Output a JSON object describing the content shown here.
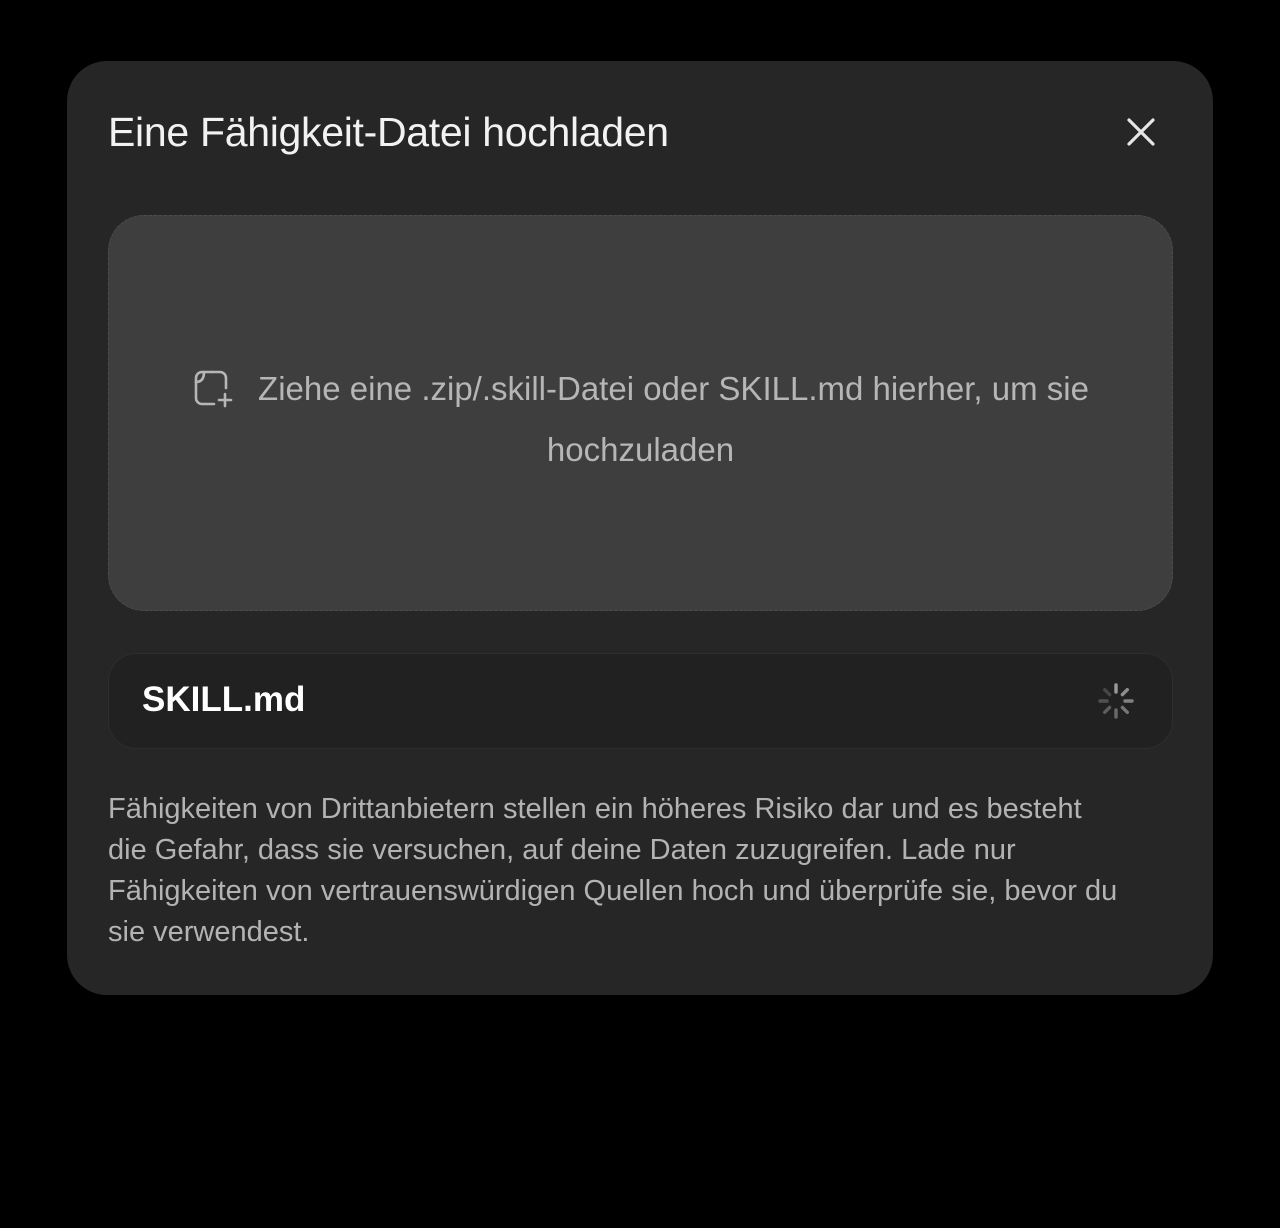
{
  "dialog": {
    "title": "Eine Fähigkeit-Datei hochladen",
    "close_icon": "close-icon"
  },
  "dropzone": {
    "icon": "file-add-icon",
    "text": "Ziehe eine .zip/.skill-Datei oder SKILL.md hierher, um sie hochzuladen"
  },
  "file": {
    "name": "SKILL.md",
    "status_icon": "loading-spinner-icon"
  },
  "warning": {
    "text": "Fähigkeiten von Drittanbietern stellen ein höheres Risiko dar und es besteht die Gefahr, dass sie versuchen, auf deine Daten zuzugreifen. Lade nur Fähigkeiten von vertrauenswürdigen Quellen hoch und überprüfe sie, bevor du sie verwendest."
  },
  "colors": {
    "page_background": "#000000",
    "dialog_background": "#262626",
    "dropzone_background": "#3e3e3e",
    "file_item_background": "#212121",
    "title_text": "#f2f2f2",
    "body_text": "#b3b3b3"
  }
}
